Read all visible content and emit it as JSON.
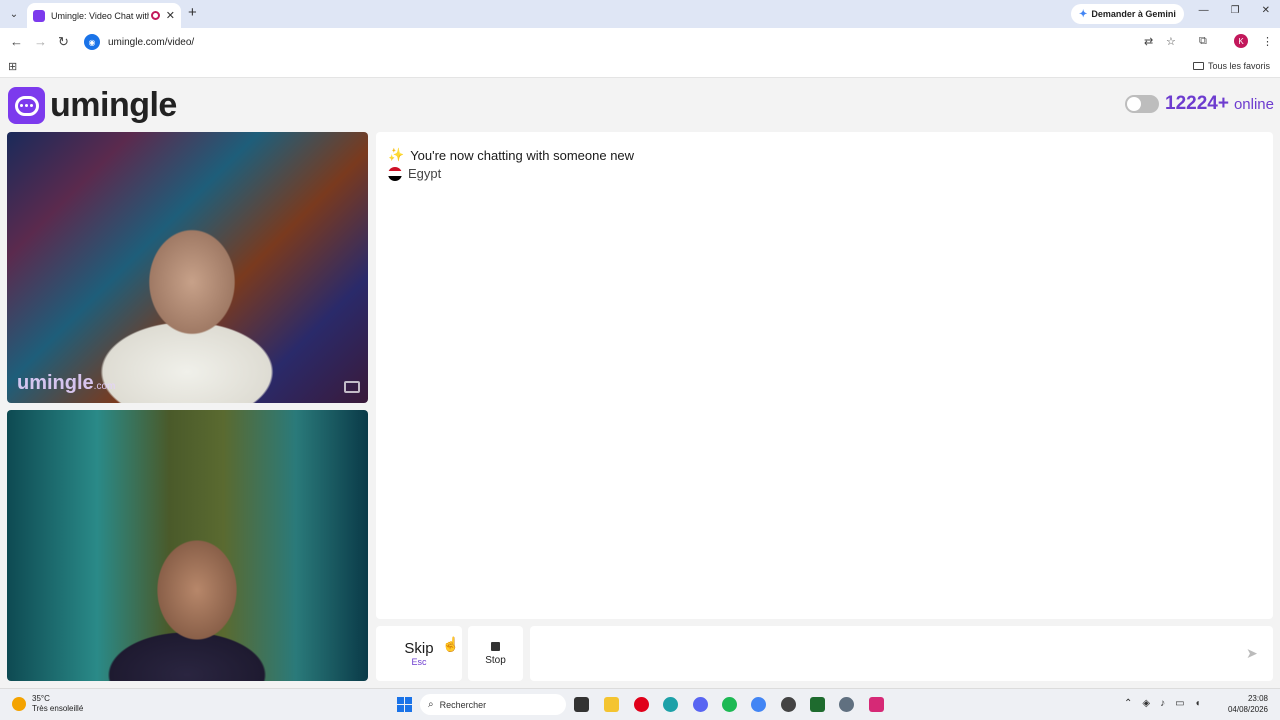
{
  "browser": {
    "tab_title": "Umingle: Video Chat with S",
    "new_tab_symbol": "+",
    "gemini_label": "Demander à Gemini",
    "url": "umingle.com/video/",
    "profile_initial": "K",
    "favorites_label": "Tous les favoris"
  },
  "site": {
    "logo_text": "umingle",
    "online_count": "12224+",
    "online_label": "online"
  },
  "videos": {
    "watermark_main": "umingle",
    "watermark_suffix": ".com"
  },
  "chat": {
    "system_message": "You're now chatting with someone new",
    "country": "Egypt"
  },
  "controls": {
    "skip_label": "Skip",
    "skip_key": "Esc",
    "stop_label": "Stop",
    "message_placeholder": ""
  },
  "taskbar": {
    "temperature": "35°C",
    "weather_desc": "Très ensoleillé",
    "search_placeholder": "Rechercher",
    "time": "23:08",
    "date": "04/08/2026"
  },
  "colors": {
    "brand": "#7c3aed",
    "online_text": "#6d3ccf"
  }
}
